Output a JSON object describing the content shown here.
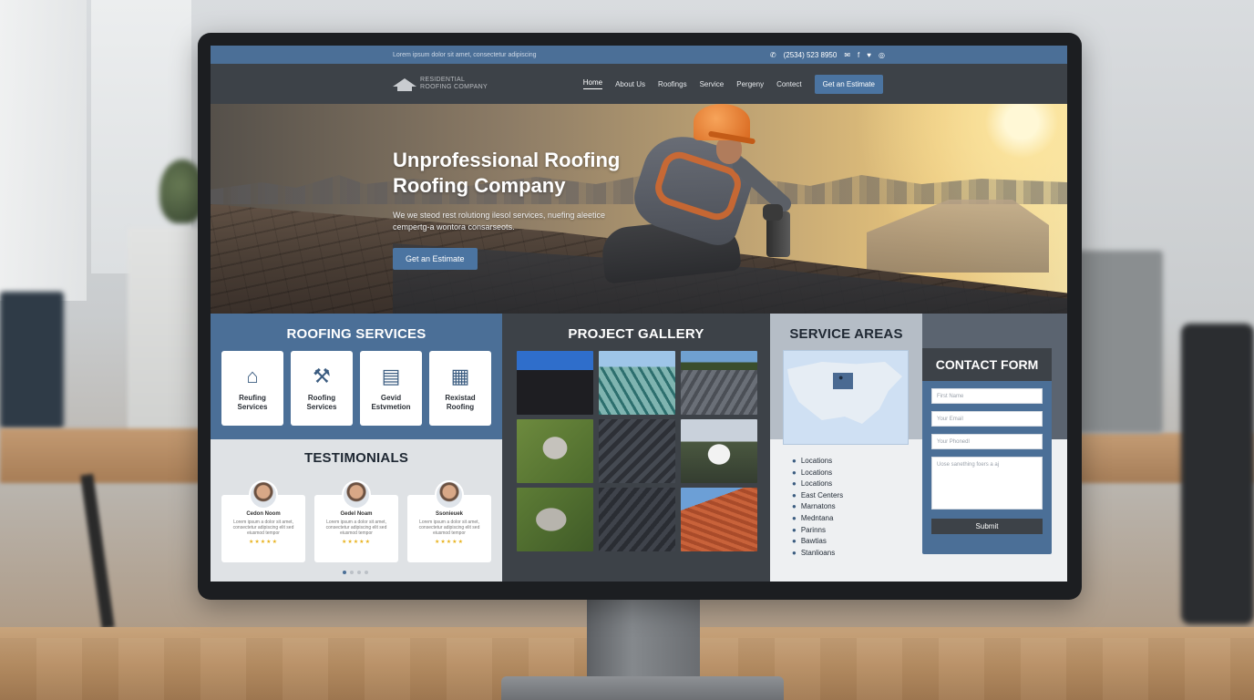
{
  "topbar": {
    "left_text": "Lorem ipsum dolor sit amet, consectetur adipiscing",
    "phone": "(2534) 523 8950",
    "icons": [
      "phone-icon",
      "mail-icon",
      "facebook-icon",
      "twitter-icon",
      "instagram-icon"
    ]
  },
  "nav": {
    "logo_line1": "RESIDENTIAL",
    "logo_line2": "ROOFING COMPANY",
    "links": [
      "Home",
      "About Us",
      "Roofings",
      "Service",
      "Pergeny",
      "Contect"
    ],
    "cta": "Get an Estimate"
  },
  "hero": {
    "title_line1": "Unprofessional Roofing",
    "title_line2": "Roofing Company",
    "subtitle": "We we steod rest rolutiong ilesol services, nuefing aleetice cempertg-a wontora consarseots.",
    "cta": "Get an Estimate"
  },
  "services": {
    "title": "ROOFING SERVICES",
    "items": [
      {
        "line1": "Reufing",
        "line2": "Services",
        "icon": "house-roof-icon"
      },
      {
        "line1": "Roofing",
        "line2": "Services",
        "icon": "tools-icon"
      },
      {
        "line1": "Gevid",
        "line2": "Estvmetion",
        "icon": "document-icon"
      },
      {
        "line1": "Rexistad",
        "line2": "Roofing",
        "icon": "solar-panel-icon"
      }
    ]
  },
  "testimonials": {
    "title": "TESTIMONIALS",
    "items": [
      {
        "name": "Cedon Noom",
        "text": "Lorem ipsum a dolor sit amet, consectetur adipiscing elit sed eiusmod tempor",
        "stars": "★★★★★"
      },
      {
        "name": "Gedel Noam",
        "text": "Lorem ipsum a dolor sit amet, consectetur adipiscing elit sed eiusmod tempor",
        "stars": "★★★★★"
      },
      {
        "name": "Ssonieuek",
        "text": "Lorem ipsum a dolor sit amet, consectetur adipiscing elit sed eiusmod tempor",
        "stars": "★★★★★"
      }
    ]
  },
  "gallery": {
    "title": "PROJECT GALLERY"
  },
  "areas": {
    "title": "SERVICE AREAS",
    "items": [
      "Locations",
      "Locations",
      "Locations",
      "East Centers",
      "Marnatons",
      "Medntana",
      "Parinns",
      "Bawtias",
      "Stanlioans"
    ]
  },
  "contact": {
    "title": "CONTACT FORM",
    "first_name_placeholder": "First Name",
    "email_placeholder": "Your Email",
    "phone_placeholder": "Your Phonedl",
    "message_placeholder": "Uose sanething foers a aj",
    "submit": "Submit"
  },
  "colors": {
    "primary_blue": "#4b6f97",
    "dark_gray": "#3d4248",
    "star_gold": "#e8b21e"
  }
}
